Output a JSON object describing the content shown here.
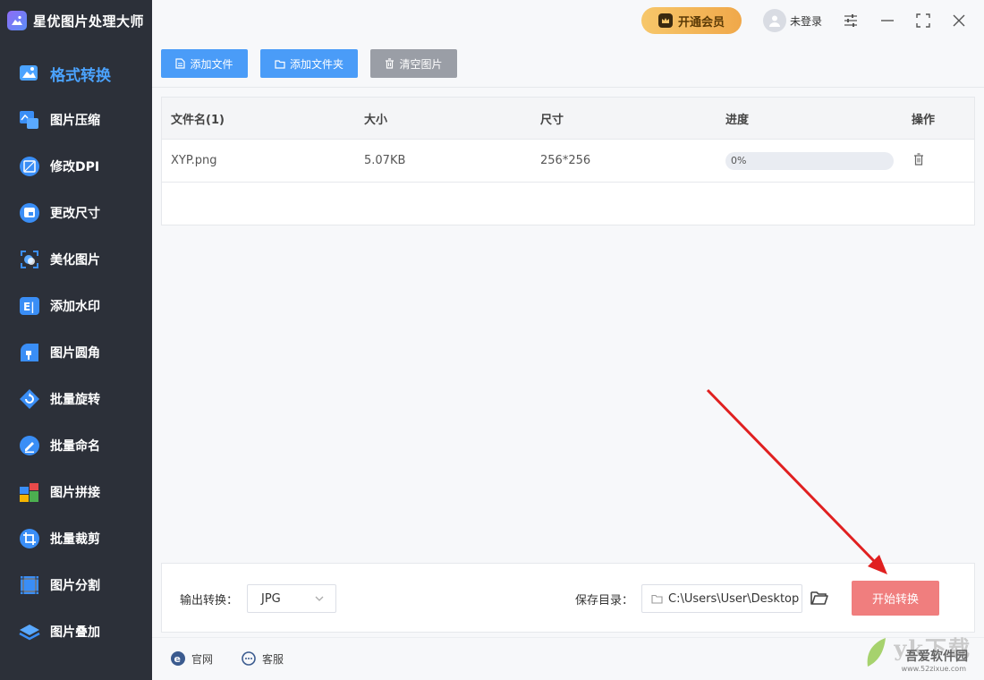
{
  "app": {
    "title": "星优图片处理大师"
  },
  "sidebar": {
    "items": [
      {
        "label": "格式转换",
        "icon": "format-convert-icon",
        "active": true
      },
      {
        "label": "图片压缩",
        "icon": "compress-icon"
      },
      {
        "label": "修改DPI",
        "icon": "dpi-icon"
      },
      {
        "label": "更改尺寸",
        "icon": "resize-icon"
      },
      {
        "label": "美化图片",
        "icon": "beautify-icon"
      },
      {
        "label": "添加水印",
        "icon": "watermark-icon"
      },
      {
        "label": "图片圆角",
        "icon": "rounded-corner-icon"
      },
      {
        "label": "批量旋转",
        "icon": "rotate-icon"
      },
      {
        "label": "批量命名",
        "icon": "rename-icon"
      },
      {
        "label": "图片拼接",
        "icon": "stitch-icon"
      },
      {
        "label": "批量裁剪",
        "icon": "crop-icon"
      },
      {
        "label": "图片分割",
        "icon": "split-icon"
      },
      {
        "label": "图片叠加",
        "icon": "overlay-icon"
      }
    ]
  },
  "header": {
    "vip_label": "开通会员",
    "user_label": "未登录"
  },
  "toolbar": {
    "add_file": "添加文件",
    "add_folder": "添加文件夹",
    "clear": "清空图片"
  },
  "table": {
    "headers": [
      "文件名(1)",
      "大小",
      "尺寸",
      "进度",
      "操作"
    ],
    "rows": [
      {
        "name": "XYP.png",
        "size": "5.07KB",
        "dims": "256*256",
        "progress_text": "0%",
        "progress": 0
      }
    ]
  },
  "bottom": {
    "output_label": "输出转换：",
    "output_format": "JPG",
    "save_label": "保存目录：",
    "save_path": "C:\\Users\\User\\Desktop",
    "start_label": "开始转换"
  },
  "footer": {
    "official_site": "官网",
    "support": "客服"
  },
  "watermark": {
    "big": "yk下载",
    "cn": "吾爱软件园",
    "url": "www.52zixue.com"
  },
  "colors": {
    "sidebar_bg": "#2c3039",
    "active_nav": "#4ba3ff",
    "primary_button": "#4a9cf8",
    "start_button": "#f07e7e",
    "vip_gradient_start": "#f7c76a",
    "arrow": "#e02020"
  }
}
